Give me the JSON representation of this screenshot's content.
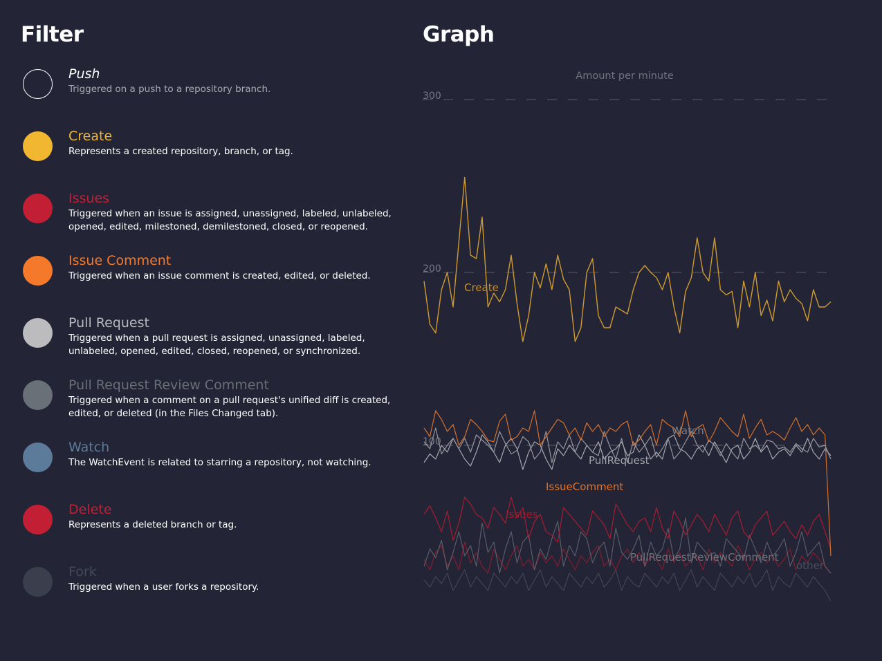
{
  "filter": {
    "title": "Filter",
    "items": [
      {
        "name": "Push",
        "description": "Triggered on a push to a repository branch.",
        "color": "#ffffff",
        "name_color": "#ffffff",
        "desc_color": "#aaaab4",
        "dot_style": "outline",
        "italic": true
      },
      {
        "name": "Create",
        "description": "Represents a created repository, branch, or tag.",
        "color": "#f2b731",
        "name_color": "#f2b731",
        "desc_color": "#ffffff",
        "dot_style": "filled"
      },
      {
        "name": "Issues",
        "description": "Triggered when an issue is assigned, unassigned, labeled, unlabeled, opened, edited, milestoned, demilestoned, closed, or reopened.",
        "color": "#c21f34",
        "name_color": "#c21f34",
        "desc_color": "#ffffff",
        "dot_style": "filled"
      },
      {
        "name": "Issue Comment",
        "description": "Triggered when an issue comment is created, edited, or deleted.",
        "color": "#f5792a",
        "name_color": "#f5792a",
        "desc_color": "#ffffff",
        "dot_style": "filled"
      },
      {
        "name": "Pull Request",
        "description": "Triggered when a pull request is assigned, unassigned, labeled, unlabeled, opened, edited, closed, reopened, or synchronized.",
        "color": "#bcbcbe",
        "name_color": "#b9b9bc",
        "desc_color": "#ffffff",
        "dot_style": "filled"
      },
      {
        "name": "Pull Request Review Comment",
        "description": "Triggered when a comment on a pull request's unified diff is created, edited, or deleted (in the Files Changed tab).",
        "color": "#6a7078",
        "name_color": "#6a6e76",
        "desc_color": "#ffffff",
        "dot_style": "filled"
      },
      {
        "name": "Watch",
        "description": "The WatchEvent is related to starring a repository, not watching.",
        "color": "#5c7a99",
        "name_color": "#5c7a99",
        "desc_color": "#ffffff",
        "dot_style": "filled"
      },
      {
        "name": "Delete",
        "description": "Represents a deleted branch or tag.",
        "color": "#c21f34",
        "name_color": "#c21f34",
        "desc_color": "#ffffff",
        "dot_style": "filled"
      },
      {
        "name": "Fork",
        "description": "Triggered when a user forks a repository.",
        "color": "#3b3e4d",
        "name_color": "#454856",
        "desc_color": "#ffffff",
        "dot_style": "filled"
      }
    ]
  },
  "graph": {
    "title": "Graph"
  },
  "chart_data": {
    "type": "line",
    "title": "Amount per minute",
    "ylim": [
      0,
      300
    ],
    "yticks": [
      100,
      200,
      300
    ],
    "grid": true,
    "series": [
      {
        "name": "Create",
        "color": "#d9a12e",
        "values": [
          195,
          170,
          165,
          190,
          200,
          180,
          218,
          255,
          210,
          208,
          232,
          180,
          188,
          183,
          190,
          210,
          182,
          160,
          175,
          200,
          191,
          205,
          190,
          210,
          196,
          190,
          160,
          168,
          200,
          208,
          175,
          168,
          168,
          180,
          178,
          176,
          190,
          200,
          204,
          200,
          197,
          190,
          200,
          180,
          165,
          189,
          197,
          220,
          200,
          195,
          220,
          190,
          187,
          189,
          168,
          195,
          180,
          200,
          175,
          184,
          172,
          195,
          183,
          190,
          185,
          182,
          172,
          190,
          180,
          180,
          183
        ],
        "label": "Create",
        "label_color": "#c48f26"
      },
      {
        "name": "IssueComment",
        "color": "#e0742a",
        "values": [
          110,
          105,
          120,
          115,
          108,
          112,
          100,
          105,
          115,
          112,
          108,
          103,
          102,
          114,
          118,
          103,
          105,
          110,
          108,
          120,
          100,
          105,
          110,
          115,
          113,
          106,
          110,
          103,
          113,
          108,
          112,
          105,
          110,
          108,
          112,
          114,
          100,
          103,
          108,
          112,
          100,
          115,
          112,
          110,
          105,
          120,
          105,
          110,
          112,
          102,
          108,
          116,
          112,
          108,
          105,
          118,
          104,
          110,
          115,
          106,
          108,
          106,
          103,
          110,
          116,
          108,
          112,
          106,
          110,
          106,
          36
        ],
        "label": "IssueComment",
        "label_color": "#e0742a"
      },
      {
        "name": "PullRequest",
        "color": "#9c9ca3",
        "values": [
          102,
          98,
          110,
          95,
          100,
          104,
          98,
          104,
          96,
          106,
          103,
          100,
          96,
          108,
          101,
          95,
          97,
          105,
          102,
          92,
          96,
          108,
          90,
          102,
          98,
          106,
          96,
          104,
          100,
          96,
          94,
          108,
          99,
          92,
          104,
          90,
          102,
          96,
          100,
          105,
          93,
          98,
          104,
          92,
          96,
          102,
          108,
          100,
          96,
          103,
          100,
          94,
          101,
          96,
          92,
          104,
          98,
          100,
          97,
          103,
          102,
          98,
          99,
          96,
          101,
          98,
          96,
          104,
          99,
          100,
          92
        ],
        "label": "PullRequest",
        "label_color": "#a4a4aa"
      },
      {
        "name": "Watch",
        "color": "#aeb0b6",
        "values": [
          90,
          95,
          92,
          100,
          96,
          104,
          98,
          92,
          88,
          96,
          106,
          102,
          96,
          90,
          100,
          104,
          98,
          86,
          96,
          102,
          100,
          92,
          86,
          98,
          94,
          100,
          96,
          92,
          100,
          96,
          102,
          92,
          96,
          98,
          102,
          94,
          96,
          106,
          100,
          92,
          96,
          92,
          104,
          106,
          98,
          96,
          92,
          98,
          100,
          94,
          102,
          96,
          90,
          98,
          100,
          92,
          96,
          104,
          96,
          100,
          92,
          96,
          98,
          94,
          100,
          96,
          104,
          96,
          92,
          98,
          94
        ],
        "label": "Watch",
        "label_color": "#7a7b85"
      },
      {
        "name": "Issues",
        "color": "#b01b30",
        "values": [
          60,
          65,
          58,
          50,
          62,
          45,
          55,
          70,
          66,
          60,
          58,
          52,
          64,
          60,
          55,
          70,
          58,
          64,
          46,
          56,
          60,
          50,
          48,
          44,
          64,
          60,
          56,
          52,
          48,
          62,
          58,
          54,
          46,
          66,
          60,
          54,
          50,
          56,
          58,
          50,
          64,
          52,
          46,
          62,
          56,
          48,
          54,
          60,
          56,
          50,
          60,
          54,
          48,
          58,
          62,
          50,
          46,
          54,
          58,
          62,
          48,
          52,
          56,
          50,
          46,
          54,
          48,
          56,
          60,
          50,
          40
        ],
        "label": "Issues",
        "label_color": "#a41a2e"
      },
      {
        "name": "PullRequestReviewComment",
        "color": "#666a75",
        "values": [
          30,
          40,
          35,
          45,
          28,
          38,
          50,
          36,
          42,
          30,
          55,
          38,
          44,
          26,
          40,
          50,
          32,
          44,
          48,
          28,
          40,
          34,
          46,
          56,
          30,
          42,
          36,
          50,
          46,
          32,
          40,
          44,
          30,
          52,
          38,
          34,
          40,
          48,
          30,
          44,
          36,
          40,
          52,
          34,
          40,
          58,
          32,
          44,
          40,
          36,
          38,
          30,
          46,
          42,
          38,
          34,
          48,
          40,
          32,
          44,
          36,
          40,
          46,
          30,
          38,
          50,
          36,
          40,
          44,
          30,
          26
        ],
        "label": "PullRequestReviewComment",
        "label_color": "#6e717c"
      },
      {
        "name": "Delete",
        "color": "#9e1a2c",
        "values": [
          34,
          28,
          38,
          42,
          30,
          36,
          28,
          44,
          32,
          38,
          30,
          26,
          40,
          34,
          28,
          36,
          42,
          30,
          34,
          28,
          38,
          32,
          36,
          30,
          40,
          34,
          28,
          36,
          32,
          38,
          42,
          30,
          34,
          28,
          36,
          40,
          32,
          38,
          30,
          36,
          34,
          28,
          40,
          32,
          38,
          30,
          34,
          36,
          28,
          40,
          32,
          38,
          34,
          30,
          42,
          36,
          28,
          34,
          38,
          32,
          36,
          30,
          34,
          40,
          28,
          36,
          32,
          38,
          34,
          30,
          26
        ],
        "label": "",
        "label_color": "#9e1a2c"
      },
      {
        "name": "other",
        "color": "#4b4e5c",
        "values": [
          22,
          18,
          24,
          20,
          26,
          16,
          22,
          28,
          18,
          24,
          20,
          16,
          26,
          22,
          18,
          24,
          20,
          26,
          16,
          22,
          28,
          18,
          24,
          20,
          16,
          26,
          22,
          18,
          24,
          20,
          26,
          18,
          22,
          28,
          16,
          24,
          20,
          18,
          26,
          22,
          18,
          24,
          20,
          26,
          16,
          22,
          28,
          18,
          24,
          20,
          16,
          26,
          22,
          18,
          24,
          20,
          26,
          18,
          22,
          28,
          16,
          24,
          20,
          18,
          26,
          22,
          18,
          24,
          20,
          16,
          10
        ],
        "label": "other",
        "label_color": "#4b4e5c"
      }
    ],
    "title_color": "#71737f",
    "tick_color": "#767883",
    "grid_color": "#5a5c68"
  }
}
